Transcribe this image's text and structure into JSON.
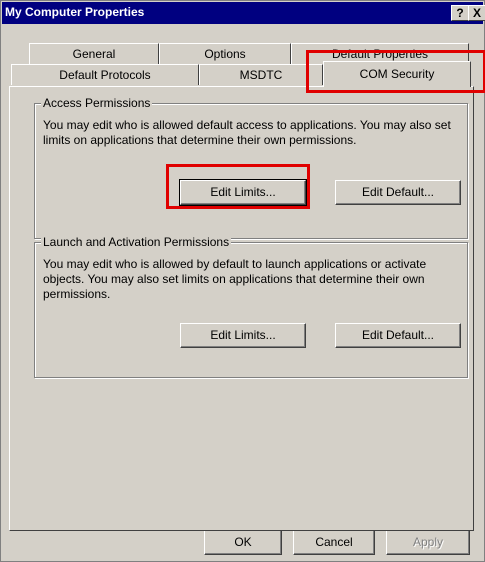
{
  "window": {
    "title": "My Computer Properties",
    "help_glyph": "?",
    "close_glyph": "X"
  },
  "tabs": {
    "row1": [
      "General",
      "Options",
      "Default Properties"
    ],
    "row2": [
      "Default Protocols",
      "MSDTC",
      "COM Security"
    ],
    "active": "COM Security"
  },
  "access": {
    "legend": "Access Permissions",
    "text": "You may edit who is allowed default access to applications. You may also set limits on applications that determine their own permissions.",
    "edit_limits": "Edit Limits...",
    "edit_default": "Edit Default..."
  },
  "launch": {
    "legend": "Launch and Activation Permissions",
    "text": "You may edit who is allowed by default to launch applications or activate objects. You may also set limits on applications that determine their own permissions.",
    "edit_limits": "Edit Limits...",
    "edit_default": "Edit Default..."
  },
  "footer": {
    "ok": "OK",
    "cancel": "Cancel",
    "apply": "Apply"
  },
  "highlight_color": "#e00000"
}
